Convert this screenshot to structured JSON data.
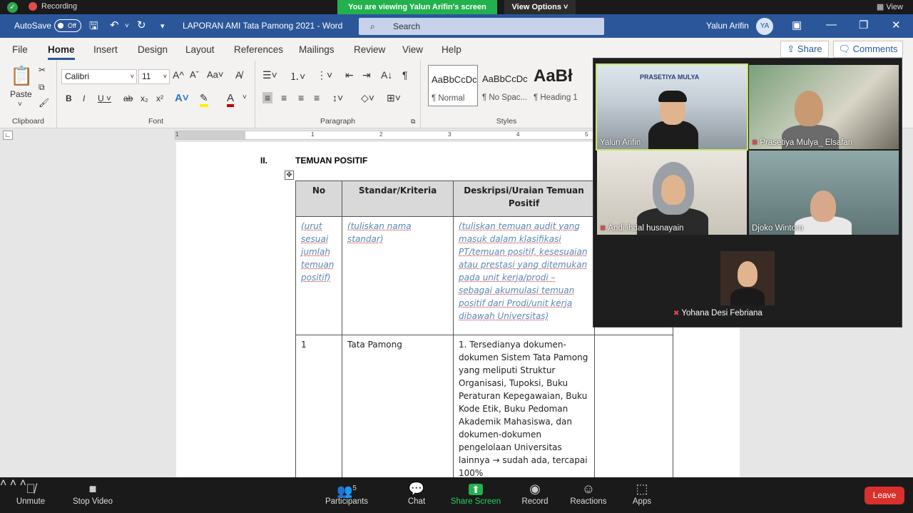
{
  "zoom": {
    "recording": "Recording",
    "viewing_banner": "You are viewing Yalun Arifin's screen",
    "view_options": "View Options ˅",
    "view": "View",
    "participants_count": "5",
    "bottom": {
      "unmute": "Unmute",
      "stop_video": "Stop Video",
      "participants": "Participants",
      "chat": "Chat",
      "share_screen": "Share Screen",
      "record": "Record",
      "reactions": "Reactions",
      "apps": "Apps",
      "leave": "Leave"
    },
    "tiles": [
      {
        "name": "Yalun Arifin",
        "logo": "PRASETIYA MULYA"
      },
      {
        "name": "Prasetiya Mulya_ Elsafan"
      },
      {
        "name": "Andi ihdal husnayain"
      },
      {
        "name": "Djoko Wintoro"
      },
      {
        "name": "Yohana Desi Febriana"
      }
    ]
  },
  "word": {
    "autosave": "AutoSave",
    "autosave_state": "Off",
    "doc_title": "LAPORAN AMI Tata Pamong 2021  -  Word",
    "search_placeholder": "Search",
    "user": "Yalun Arifin",
    "user_initials": "YA",
    "tabs": [
      "File",
      "Home",
      "Insert",
      "Design",
      "Layout",
      "References",
      "Mailings",
      "Review",
      "View",
      "Help"
    ],
    "share": "Share",
    "comments": "Comments",
    "ribbon": {
      "clipboard": "Clipboard",
      "paste": "Paste",
      "font": "Font",
      "font_name": "Calibri",
      "font_size": "11",
      "paragraph": "Paragraph",
      "styles": "Styles",
      "style_items": [
        {
          "preview": "AaBbCcDc",
          "name": "¶ Normal"
        },
        {
          "preview": "AaBbCcDc",
          "name": "¶ No Spac..."
        },
        {
          "preview": "AaBł",
          "name": "¶ Heading 1"
        }
      ]
    },
    "ruler_numbers": [
      "1",
      "1",
      "2",
      "3",
      "4",
      "5"
    ],
    "document": {
      "section_no": "II.",
      "section_title": "TEMUAN POSITIF",
      "headers": [
        "No",
        "Standar/Kriteria",
        "Deskripsi/Uraian Temuan Positif"
      ],
      "guide_row": [
        "(urut sesuai jumlah temuan positif)",
        "(tuliskan nama standar)",
        "(tuliskan temuan audit yang masuk dalam klasifikasi PT/temuan positif, kesesuaian atau prestasi yang ditemukan pada unit kerja/prodi – sebagai akumulasi temuan positif dari Prodi/unit kerja dibawah Universitas)"
      ],
      "row1": [
        "1",
        "Tata Pamong",
        "1. Tersedianya dokumen-dokumen Sistem Tata Pamong yang meliputi Struktur Organisasi, Tupoksi, Buku Peraturan Kepegawaian, Buku Kode Etik, Buku Pedoman Akademik Mahasiswa, dan dokumen-dokumen pengelolaan Universitas lainnya → sudah ada, tercapai 100%"
      ]
    }
  }
}
